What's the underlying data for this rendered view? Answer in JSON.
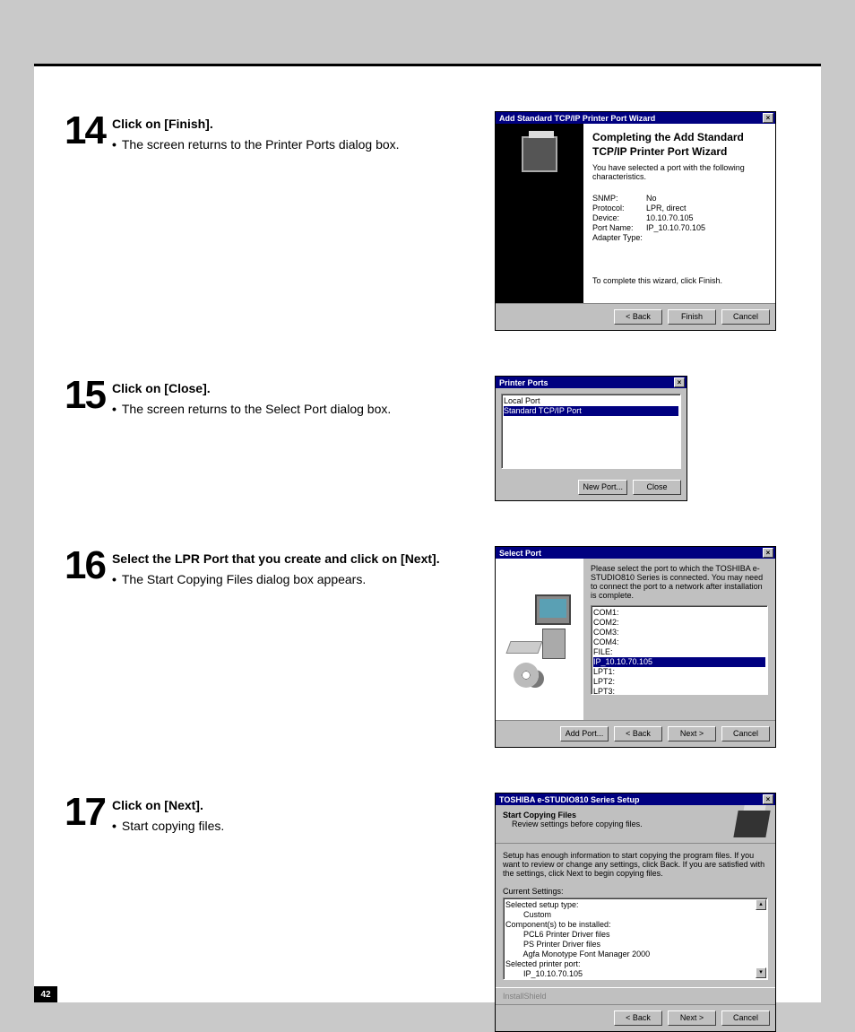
{
  "page_number": "42",
  "steps": [
    {
      "num": "14",
      "heading": "Click on [Finish].",
      "bullet": "The screen returns to the Printer Ports dialog box.",
      "dialog": {
        "title": "Add Standard TCP/IP Printer Port Wizard",
        "h1": "Completing the Add Standard",
        "h2": "TCP/IP Printer Port Wizard",
        "intro": "You have selected a port with the following characteristics.",
        "pairs": [
          {
            "k": "SNMP:",
            "v": "No"
          },
          {
            "k": "Protocol:",
            "v": "LPR, direct"
          },
          {
            "k": "Device:",
            "v": "10.10.70.105"
          },
          {
            "k": "Port Name:",
            "v": "IP_10.10.70.105"
          },
          {
            "k": "Adapter Type:",
            "v": ""
          }
        ],
        "complete": "To complete this wizard, click Finish.",
        "buttons": {
          "back": "< Back",
          "finish": "Finish",
          "cancel": "Cancel"
        }
      }
    },
    {
      "num": "15",
      "heading": "Click on [Close].",
      "bullet": "The screen returns to the Select Port dialog box.",
      "dialog": {
        "title": "Printer Ports",
        "items": [
          "Local Port",
          "Standard TCP/IP Port"
        ],
        "buttons": {
          "new": "New Port...",
          "close": "Close"
        }
      }
    },
    {
      "num": "16",
      "heading": "Select the LPR Port that you create and click on [Next].",
      "bullet": "The Start Copying Files dialog box appears.",
      "dialog": {
        "title": "Select Port",
        "desc": "Please select the port to which the TOSHIBA e-STUDIO810 Series is connected. You may need to connect the port to a network after installation is complete.",
        "items": [
          "COM1:",
          "COM2:",
          "COM3:",
          "COM4:",
          "FILE:",
          "IP_10.10.70.105",
          "LPT1:",
          "LPT2:",
          "LPT3:"
        ],
        "selected_index": 5,
        "buttons": {
          "add": "Add Port...",
          "back": "< Back",
          "next": "Next >",
          "cancel": "Cancel"
        }
      }
    },
    {
      "num": "17",
      "heading": "Click on [Next].",
      "bullet": "Start copying files.",
      "dialog": {
        "title": "TOSHIBA e-STUDIO810 Series Setup",
        "h": "Start Copying Files",
        "sub": "Review settings before copying files.",
        "desc": "Setup has enough information to start copying the program files. If you want to review or change any settings, click Back. If you are satisfied with the settings, click Next to begin copying files.",
        "cur_label": "Current Settings:",
        "lines": [
          "Selected setup type:",
          "        Custom",
          "Component(s) to be installed:",
          "        PCL6 Printer Driver files",
          "        PS Printer Driver files",
          "        Agfa Monotype Font Manager 2000",
          "Selected printer port:",
          "        IP_10.10.70.105"
        ],
        "status": "InstallShield",
        "buttons": {
          "back": "< Back",
          "next": "Next >",
          "cancel": "Cancel"
        }
      }
    }
  ]
}
